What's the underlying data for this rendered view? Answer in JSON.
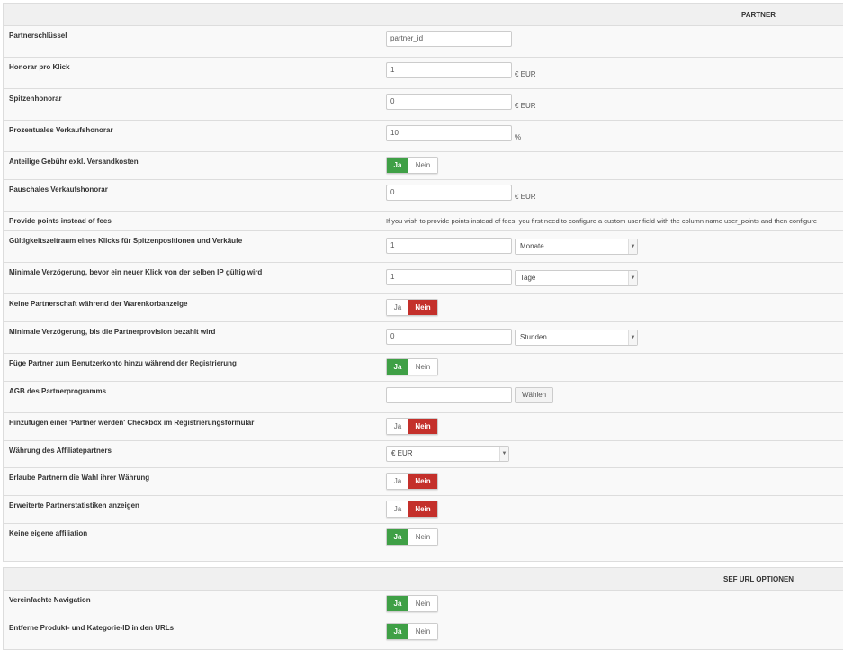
{
  "colors": {
    "yes_active": "#3fa046",
    "no_active": "#c4302b"
  },
  "sections": [
    {
      "title": "PARTNER",
      "rows": [
        {
          "label": "Partnerschlüssel",
          "type": "input",
          "value": "partner_id",
          "h": 35
        },
        {
          "label": "Honorar pro Klick",
          "type": "input",
          "value": "1",
          "unit": "€ EUR",
          "h": 35
        },
        {
          "label": "Spitzenhonorar",
          "type": "input",
          "value": "0",
          "unit": "€ EUR",
          "h": 35
        },
        {
          "label": "Prozentuales Verkaufshonorar",
          "type": "input",
          "value": "10",
          "unit": "%",
          "h": 35
        },
        {
          "label": "Anteilige Gebühr exkl. Versandkosten",
          "type": "toggle",
          "yes": "Ja",
          "no": "Nein",
          "selected": "Ja",
          "h": 31
        },
        {
          "label": "Pauschales Verkaufshonorar",
          "type": "input",
          "value": "0",
          "unit": "€ EUR",
          "h": 35
        },
        {
          "label": "Provide points instead of fees",
          "type": "note",
          "text": "If you wish to provide points instead of fees, you first need to configure a custom user field with the column name user_points and then configure",
          "h": 22
        },
        {
          "label": "Gültigkeitszeitraum eines Klicks für Spitzenpositionen und Verkäufe",
          "type": "inputselect",
          "value": "1",
          "select": "Monate",
          "h": 35
        },
        {
          "label": "Minimale Verzögerung, bevor ein neuer Klick von der selben IP gültig wird",
          "type": "inputselect",
          "value": "1",
          "select": "Tage",
          "h": 35
        },
        {
          "label": "Keine Partnerschaft während der Warenkorbanzeige",
          "type": "toggle",
          "yes": "Ja",
          "no": "Nein",
          "selected": "Nein",
          "h": 31
        },
        {
          "label": "Minimale Verzögerung, bis die Partnerprovision bezahlt wird",
          "type": "inputselect",
          "value": "0",
          "select": "Stunden",
          "h": 35
        },
        {
          "label": "Füge Partner zum Benutzerkonto hinzu während der Registrierung",
          "type": "toggle",
          "yes": "Ja",
          "no": "Nein",
          "selected": "Ja",
          "h": 31
        },
        {
          "label": "AGB des Partnerprogramms",
          "type": "file",
          "value": "",
          "button": "Wählen",
          "h": 35
        },
        {
          "label": "Hinzufügen einer 'Partner werden' Checkbox im Registrierungsformular",
          "type": "toggle",
          "yes": "Ja",
          "no": "Nein",
          "selected": "Nein",
          "h": 31
        },
        {
          "label": "Währung des Affiliatepartners",
          "type": "select",
          "select": "€ EUR",
          "h": 30
        },
        {
          "label": "Erlaube Partnern die Wahl ihrer Währung",
          "type": "toggle",
          "yes": "Ja",
          "no": "Nein",
          "selected": "Nein",
          "h": 31
        },
        {
          "label": "Erweiterte Partnerstatistiken anzeigen",
          "type": "toggle",
          "yes": "Ja",
          "no": "Nein",
          "selected": "Nein",
          "h": 31
        },
        {
          "label": "Keine eigene affiliation",
          "type": "toggle",
          "yes": "Ja",
          "no": "Nein",
          "selected": "Ja",
          "h": 42
        }
      ]
    },
    {
      "title": "SEF URL OPTIONEN",
      "rows": [
        {
          "label": "Vereinfachte Navigation",
          "type": "toggle",
          "yes": "Ja",
          "no": "Nein",
          "selected": "Ja",
          "h": 31
        },
        {
          "label": "Entferne Produkt- und Kategorie-ID in den URLs",
          "type": "toggle",
          "yes": "Ja",
          "no": "Nein",
          "selected": "Ja",
          "h": 35
        }
      ]
    }
  ]
}
